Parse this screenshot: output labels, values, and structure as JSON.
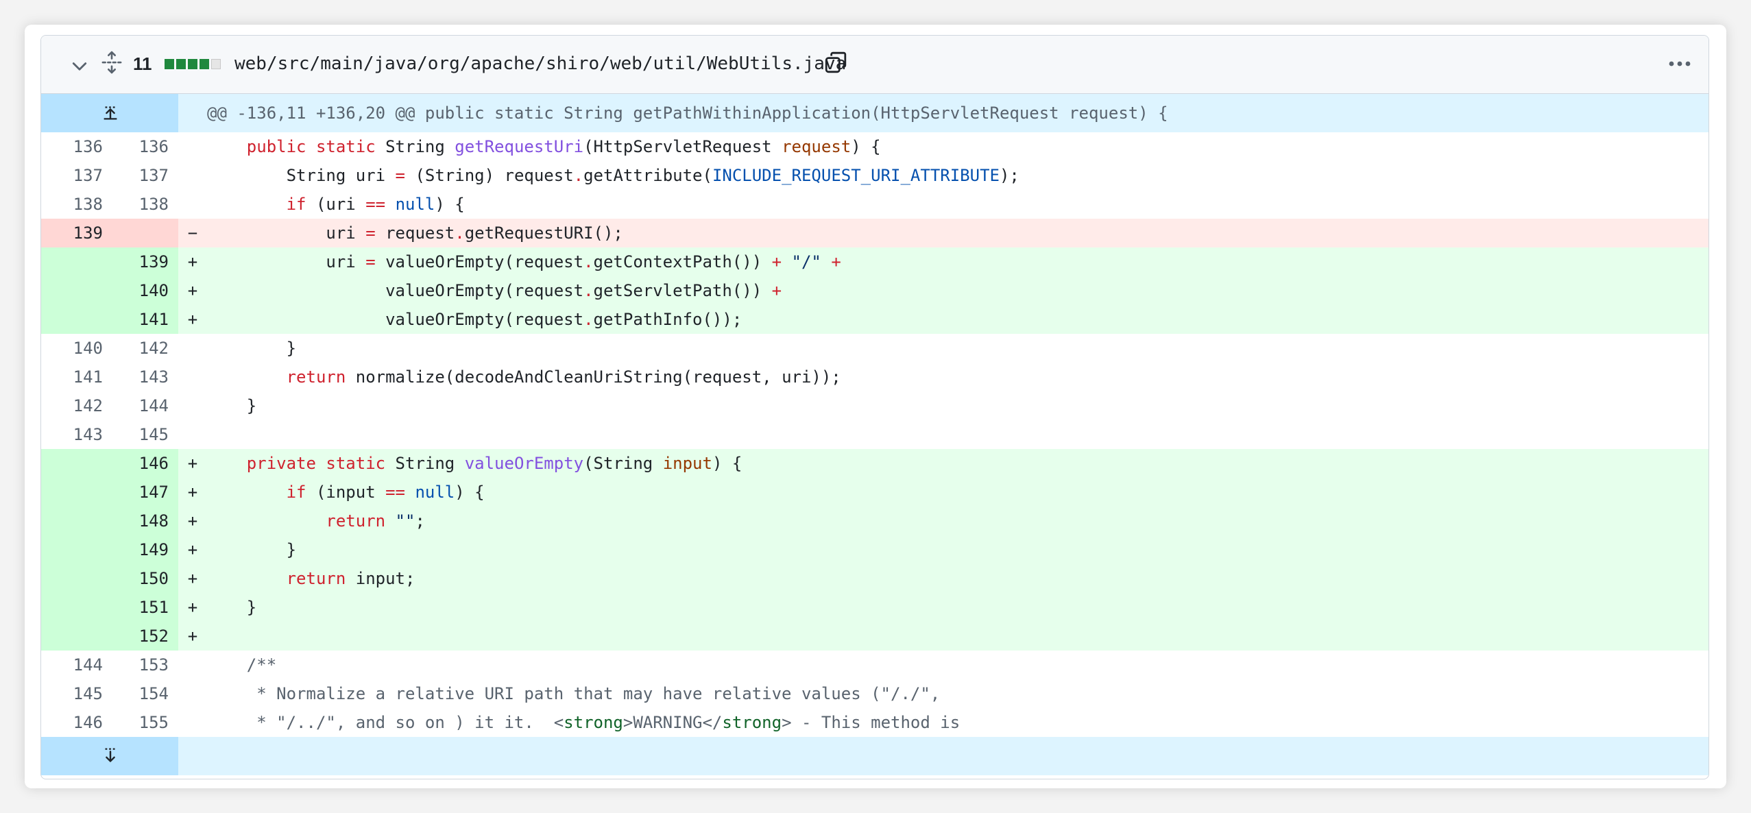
{
  "file": {
    "changes_count": "11",
    "path": "web/src/main/java/org/apache/shiro/web/util/WebUtils.java",
    "diffstat": [
      "added",
      "added",
      "added",
      "added",
      "neutral"
    ],
    "colors": {
      "added": "#1f883d",
      "neutral": "#e6e6e6"
    }
  },
  "hunk": {
    "header": "@@ -136,11 +136,20 @@ public static String getPathWithinApplication(HttpServletRequest request) {"
  },
  "lines": [
    {
      "type": "ctx",
      "old": "136",
      "new": "136",
      "marker": "",
      "tokens": [
        [
          "    ",
          ""
        ],
        [
          "public",
          "kw"
        ],
        [
          " ",
          ""
        ],
        [
          "static",
          "kw"
        ],
        [
          " String ",
          ""
        ],
        [
          "getRequestUri",
          "fn"
        ],
        [
          "(HttpServletRequest ",
          ""
        ],
        [
          "request",
          "prm"
        ],
        [
          ") {",
          ""
        ]
      ]
    },
    {
      "type": "ctx",
      "old": "137",
      "new": "137",
      "marker": "",
      "tokens": [
        [
          "        String uri ",
          ""
        ],
        [
          "=",
          "op"
        ],
        [
          " (String) request",
          ""
        ],
        [
          ".",
          "op"
        ],
        [
          "getAttribute(",
          ""
        ],
        [
          "INCLUDE_REQUEST_URI_ATTRIBUTE",
          "cst"
        ],
        [
          ");",
          ""
        ]
      ]
    },
    {
      "type": "ctx",
      "old": "138",
      "new": "138",
      "marker": "",
      "tokens": [
        [
          "        ",
          ""
        ],
        [
          "if",
          "kw"
        ],
        [
          " (uri ",
          ""
        ],
        [
          "==",
          "op"
        ],
        [
          " ",
          ""
        ],
        [
          "null",
          "cst"
        ],
        [
          ") {",
          ""
        ]
      ]
    },
    {
      "type": "del",
      "old": "139",
      "new": "",
      "marker": "−",
      "tokens": [
        [
          "            uri ",
          ""
        ],
        [
          "=",
          "op"
        ],
        [
          " request",
          ""
        ],
        [
          ".",
          "op"
        ],
        [
          "getRequestURI();",
          ""
        ]
      ]
    },
    {
      "type": "add",
      "old": "",
      "new": "139",
      "marker": "+",
      "tokens": [
        [
          "            uri ",
          ""
        ],
        [
          "=",
          "op"
        ],
        [
          " valueOrEmpty(request",
          ""
        ],
        [
          ".",
          "op"
        ],
        [
          "getContextPath()) ",
          ""
        ],
        [
          "+",
          "op"
        ],
        [
          " ",
          ""
        ],
        [
          "\"/\"",
          "str"
        ],
        [
          " ",
          ""
        ],
        [
          "+",
          "op"
        ]
      ]
    },
    {
      "type": "add",
      "old": "",
      "new": "140",
      "marker": "+",
      "tokens": [
        [
          "                  valueOrEmpty(request",
          ""
        ],
        [
          ".",
          "op"
        ],
        [
          "getServletPath()) ",
          ""
        ],
        [
          "+",
          "op"
        ]
      ]
    },
    {
      "type": "add",
      "old": "",
      "new": "141",
      "marker": "+",
      "tokens": [
        [
          "                  valueOrEmpty(request",
          ""
        ],
        [
          ".",
          "op"
        ],
        [
          "getPathInfo());",
          ""
        ]
      ]
    },
    {
      "type": "ctx",
      "old": "140",
      "new": "142",
      "marker": "",
      "tokens": [
        [
          "        }",
          ""
        ]
      ]
    },
    {
      "type": "ctx",
      "old": "141",
      "new": "143",
      "marker": "",
      "tokens": [
        [
          "        ",
          ""
        ],
        [
          "return",
          "kw"
        ],
        [
          " normalize(decodeAndCleanUriString(request, uri));",
          ""
        ]
      ]
    },
    {
      "type": "ctx",
      "old": "142",
      "new": "144",
      "marker": "",
      "tokens": [
        [
          "    }",
          ""
        ]
      ]
    },
    {
      "type": "ctx",
      "old": "143",
      "new": "145",
      "marker": "",
      "tokens": [
        [
          "",
          ""
        ]
      ]
    },
    {
      "type": "add",
      "old": "",
      "new": "146",
      "marker": "+",
      "tokens": [
        [
          "    ",
          ""
        ],
        [
          "private",
          "kw"
        ],
        [
          " ",
          ""
        ],
        [
          "static",
          "kw"
        ],
        [
          " String ",
          ""
        ],
        [
          "valueOrEmpty",
          "fn"
        ],
        [
          "(String ",
          ""
        ],
        [
          "input",
          "prm"
        ],
        [
          ") {",
          ""
        ]
      ]
    },
    {
      "type": "add",
      "old": "",
      "new": "147",
      "marker": "+",
      "tokens": [
        [
          "        ",
          ""
        ],
        [
          "if",
          "kw"
        ],
        [
          " (input ",
          ""
        ],
        [
          "==",
          "op"
        ],
        [
          " ",
          ""
        ],
        [
          "null",
          "cst"
        ],
        [
          ") {",
          ""
        ]
      ]
    },
    {
      "type": "add",
      "old": "",
      "new": "148",
      "marker": "+",
      "tokens": [
        [
          "            ",
          ""
        ],
        [
          "return",
          "kw"
        ],
        [
          " ",
          ""
        ],
        [
          "\"\"",
          "str"
        ],
        [
          ";",
          ""
        ]
      ]
    },
    {
      "type": "add",
      "old": "",
      "new": "149",
      "marker": "+",
      "tokens": [
        [
          "        }",
          ""
        ]
      ]
    },
    {
      "type": "add",
      "old": "",
      "new": "150",
      "marker": "+",
      "tokens": [
        [
          "        ",
          ""
        ],
        [
          "return",
          "kw"
        ],
        [
          " input;",
          ""
        ]
      ]
    },
    {
      "type": "add",
      "old": "",
      "new": "151",
      "marker": "+",
      "tokens": [
        [
          "    }",
          ""
        ]
      ]
    },
    {
      "type": "add",
      "old": "",
      "new": "152",
      "marker": "+",
      "tokens": [
        [
          "",
          ""
        ]
      ]
    },
    {
      "type": "ctx",
      "old": "144",
      "new": "153",
      "marker": "",
      "tokens": [
        [
          "    /**",
          "cm"
        ]
      ]
    },
    {
      "type": "ctx",
      "old": "145",
      "new": "154",
      "marker": "",
      "tokens": [
        [
          "     * Normalize a relative URI path that may have relative values (\"/./\",",
          "cm"
        ]
      ]
    },
    {
      "type": "ctx",
      "old": "146",
      "new": "155",
      "marker": "",
      "tokens": [
        [
          "     * \"/../\", and so on ) it it.  <",
          "cm"
        ],
        [
          "strong",
          "tag"
        ],
        [
          ">WARNING</",
          "cm"
        ],
        [
          "strong",
          "tag"
        ],
        [
          "> - This method is",
          "cm"
        ]
      ]
    }
  ]
}
